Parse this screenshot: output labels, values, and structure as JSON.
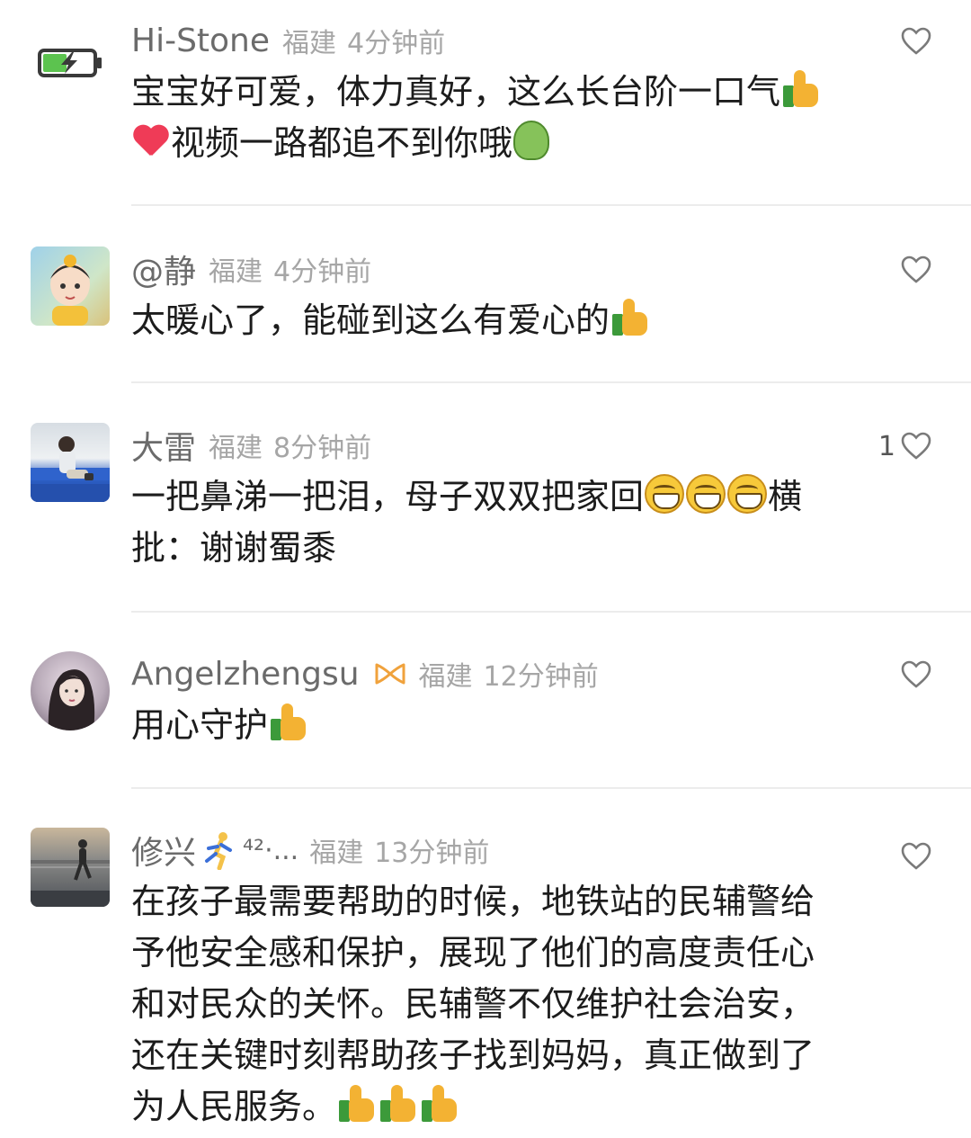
{
  "comments": [
    {
      "username": "Hi-Stone",
      "location": "福建",
      "time": "4分钟前",
      "likes": "",
      "avatar_icon": "battery-charging-icon",
      "lines": [
        "宝宝好可爱，体力真好，这么长台阶一口气",
        "视频一路都追不到你哦"
      ]
    },
    {
      "username": "@静",
      "location": "福建",
      "time": "4分钟前",
      "likes": "",
      "avatar_icon": "cartoon-girl-avatar",
      "lines": [
        "太暖心了，能碰到这么有爱心的"
      ]
    },
    {
      "username": "大雷",
      "location": "福建",
      "time": "8分钟前",
      "likes": "1",
      "avatar_icon": "child-photo-avatar",
      "lines": [
        "一把鼻涕一把泪，母子双双把家回",
        "横",
        "批：谢谢蜀黍"
      ]
    },
    {
      "username": "Angelzhengsu",
      "location": "福建",
      "time": "12分钟前",
      "likes": "",
      "avatar_icon": "woman-photo-avatar",
      "lines": [
        "用心守护"
      ]
    },
    {
      "username": "修兴",
      "name_suffix": "⁴²·...",
      "location": "福建",
      "time": "13分钟前",
      "likes": "",
      "avatar_icon": "runner-photo-avatar",
      "lines": [
        "在孩子最需要帮助的时候，地铁站的民辅警给",
        "予他安全感和保护，展现了他们的高度责任心",
        "和对民众的关怀。民辅警不仅维护社会治安，",
        "还在关键时刻帮助孩子找到妈妈，真正做到了",
        "为人民服务。"
      ]
    }
  ],
  "icons": {
    "like": "heart-outline-icon",
    "badge": "infinity-badge-icon",
    "emoji": [
      "thumbs-up-icon",
      "red-heart-icon",
      "green-blob-icon",
      "grin-icon",
      "runner-icon"
    ]
  },
  "colors": {
    "username": "#6b6b6b",
    "meta": "#a6a6a6",
    "text": "#1c1c1c",
    "divider": "#ececec",
    "badge": "#f0a23c"
  }
}
